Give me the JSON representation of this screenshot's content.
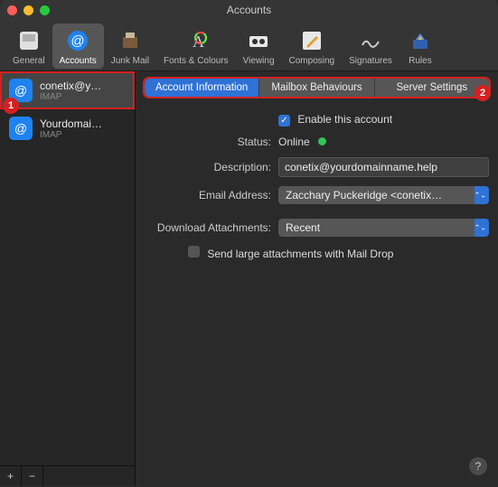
{
  "window": {
    "title": "Accounts"
  },
  "toolbar": {
    "items": [
      {
        "label": "General"
      },
      {
        "label": "Accounts"
      },
      {
        "label": "Junk Mail"
      },
      {
        "label": "Fonts & Colours"
      },
      {
        "label": "Viewing"
      },
      {
        "label": "Composing"
      },
      {
        "label": "Signatures"
      },
      {
        "label": "Rules"
      }
    ]
  },
  "sidebar": {
    "accounts": [
      {
        "name": "conetix@y…",
        "protocol": "IMAP"
      },
      {
        "name": "Yourdomai…",
        "protocol": "IMAP"
      }
    ],
    "add": "+",
    "remove": "−"
  },
  "content": {
    "tabs": [
      {
        "label": "Account Information"
      },
      {
        "label": "Mailbox Behaviours"
      },
      {
        "label": "Server Settings"
      }
    ],
    "enable_label": "Enable this account",
    "status_label": "Status:",
    "status_value": "Online",
    "description_label": "Description:",
    "description_value": "conetix@yourdomainname.help",
    "email_label": "Email Address:",
    "email_value": "Zacchary Puckeridge <conetix…",
    "download_label": "Download Attachments:",
    "download_value": "Recent",
    "maildrop_label": "Send large attachments with Mail Drop"
  },
  "callouts": {
    "one": "1",
    "two": "2"
  },
  "help": "?"
}
